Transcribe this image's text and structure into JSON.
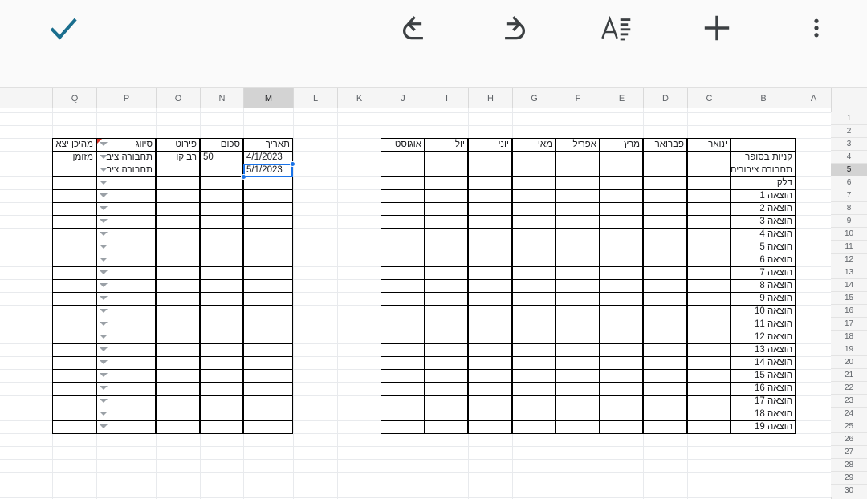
{
  "toolbar": {
    "items": [
      {
        "name": "overflow-menu-button",
        "icon": "three-dots-vertical-icon",
        "label": "תפריט"
      },
      {
        "name": "add-button",
        "icon": "plus-icon",
        "label": "הוספה"
      },
      {
        "name": "text-format-button",
        "icon": "text-format-icon",
        "label": "עיצוב טקסט"
      },
      {
        "name": "redo-button",
        "icon": "redo-icon",
        "label": "בצע שוב"
      },
      {
        "name": "undo-button",
        "icon": "undo-icon",
        "label": "בטל"
      },
      {
        "name": "confirm-button",
        "icon": "checkmark-icon",
        "label": "אישור"
      }
    ],
    "accent_color": "#1a6e8e",
    "icon_color": "#3c4043"
  },
  "sheet": {
    "columns": [
      "Q",
      "P",
      "O",
      "N",
      "M",
      "L",
      "K",
      "J",
      "I",
      "H",
      "G",
      "F",
      "E",
      "D",
      "C",
      "B",
      "A"
    ],
    "selected_column": "M",
    "rows": [
      1,
      2,
      3,
      4,
      5,
      6,
      7,
      8,
      9,
      10,
      11,
      12,
      13,
      14,
      15,
      16,
      17,
      18,
      19,
      20,
      21,
      22,
      23,
      24,
      25,
      26,
      27,
      28,
      29,
      30
    ],
    "selected_row": 5,
    "selection": {
      "cell": "M5",
      "value": "5/1/2023"
    },
    "transactions": {
      "headers": {
        "date": "תאריך",
        "amount": "סכום",
        "details": "פירוט",
        "category": "סיווג",
        "source": "מהיכן יצא"
      },
      "rows": [
        {
          "date": "4/1/2023",
          "amount": "50",
          "details": "רב קו",
          "category": "תחבורה ציב",
          "source": "מזומן"
        },
        {
          "date": "5/1/2023",
          "amount": "",
          "details": "",
          "category": "תחבורה ציב",
          "source": ""
        },
        {
          "date": "",
          "amount": "",
          "details": "",
          "category": "",
          "source": ""
        },
        {
          "date": "",
          "amount": "",
          "details": "",
          "category": "",
          "source": ""
        },
        {
          "date": "",
          "amount": "",
          "details": "",
          "category": "",
          "source": ""
        },
        {
          "date": "",
          "amount": "",
          "details": "",
          "category": "",
          "source": ""
        },
        {
          "date": "",
          "amount": "",
          "details": "",
          "category": "",
          "source": ""
        },
        {
          "date": "",
          "amount": "",
          "details": "",
          "category": "",
          "source": ""
        },
        {
          "date": "",
          "amount": "",
          "details": "",
          "category": "",
          "source": ""
        },
        {
          "date": "",
          "amount": "",
          "details": "",
          "category": "",
          "source": ""
        },
        {
          "date": "",
          "amount": "",
          "details": "",
          "category": "",
          "source": ""
        },
        {
          "date": "",
          "amount": "",
          "details": "",
          "category": "",
          "source": ""
        },
        {
          "date": "",
          "amount": "",
          "details": "",
          "category": "",
          "source": ""
        },
        {
          "date": "",
          "amount": "",
          "details": "",
          "category": "",
          "source": ""
        },
        {
          "date": "",
          "amount": "",
          "details": "",
          "category": "",
          "source": ""
        },
        {
          "date": "",
          "amount": "",
          "details": "",
          "category": "",
          "source": ""
        },
        {
          "date": "",
          "amount": "",
          "details": "",
          "category": "",
          "source": ""
        },
        {
          "date": "",
          "amount": "",
          "details": "",
          "category": "",
          "source": ""
        },
        {
          "date": "",
          "amount": "",
          "details": "",
          "category": "",
          "source": ""
        },
        {
          "date": "",
          "amount": "",
          "details": "",
          "category": "",
          "source": ""
        },
        {
          "date": "",
          "amount": "",
          "details": "",
          "category": "",
          "source": ""
        },
        {
          "date": "",
          "amount": "",
          "details": "",
          "category": "",
          "source": ""
        }
      ]
    },
    "budget": {
      "months": [
        "ינואר",
        "פברואר",
        "מרץ",
        "אפריל",
        "מאי",
        "יוני",
        "יולי",
        "אוגוסט"
      ],
      "categories": [
        "קניות בסופר",
        "תחבורה ציבורית",
        "דלק",
        "הוצאה 1",
        "הוצאה 2",
        "הוצאה 3",
        "הוצאה 4",
        "הוצאה 5",
        "הוצאה 6",
        "הוצאה 7",
        "הוצאה 8",
        "הוצאה 9",
        "הוצאה 10",
        "הוצאה 11",
        "הוצאה 12",
        "הוצאה 13",
        "הוצאה 14",
        "הוצאה 15",
        "הוצאה 16",
        "הוצאה 17",
        "הוצאה 18",
        "הוצאה 19"
      ]
    }
  }
}
